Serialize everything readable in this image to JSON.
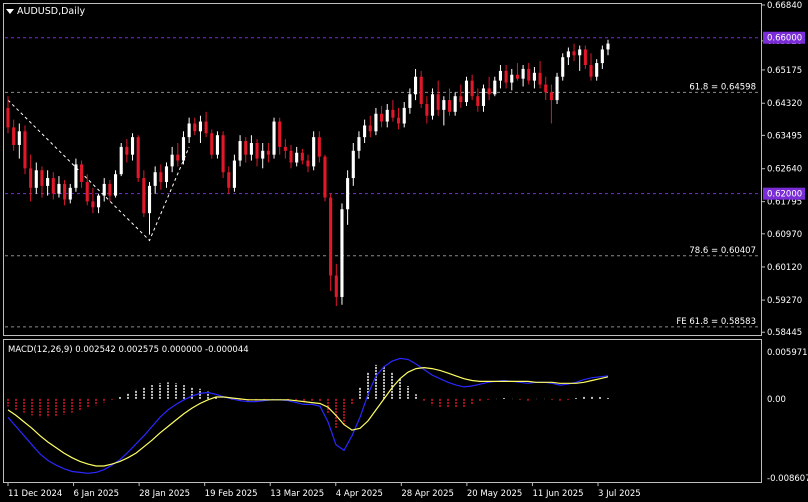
{
  "header": {
    "symbol_label": "AUDUSD,Daily"
  },
  "macd": {
    "label": "MACD(12,26,9) 0.002542 0.002575 0.000000 -0.000044",
    "scale_top": "0.005971",
    "scale_mid": "0.00",
    "scale_bottom": "-0.008607",
    "ylim": [
      -0.008607,
      0.005971
    ]
  },
  "price_axis": {
    "ticks": [
      "0.66840",
      "0.65920",
      "0.65175",
      "0.64320",
      "0.63495",
      "0.62640",
      "0.61795",
      "0.60970",
      "0.60120",
      "0.59270",
      "0.58445"
    ],
    "highlight_ticks": [
      "0.66000",
      "0.62000"
    ]
  },
  "levels": [
    {
      "label": "61.8 = 0.64598",
      "value": 0.64598
    },
    {
      "label": "78.6 = 0.60407",
      "value": 0.60407
    },
    {
      "label": "FE 61.8 = 0.58583",
      "value": 0.58583
    }
  ],
  "hlines": [
    0.66,
    0.62
  ],
  "time_axis": [
    "11 Dec 2024",
    "6 Jan 2025",
    "28 Jan 2025",
    "19 Feb 2025",
    "13 Mar 2025",
    "4 Apr 2025",
    "28 Apr 2025",
    "20 May 2025",
    "11 Jun 2025",
    "3 Jul 2025"
  ],
  "colors": {
    "bull": "#ffffff",
    "bear": "#e0182a",
    "macd_line": "#2828ff",
    "signal_line": "#ffff66",
    "level_line": "#8c8c8c",
    "hline": "#7a2cd6",
    "hist_pos": "#ffffff",
    "hist_neg": "#e0182a"
  },
  "chart_data": {
    "type": "candlestick",
    "title": "AUDUSD,Daily",
    "ylim": [
      0.584,
      0.6684
    ],
    "candles": [
      {
        "o": 0.642,
        "h": 0.645,
        "l": 0.6355,
        "c": 0.637
      },
      {
        "o": 0.637,
        "h": 0.639,
        "l": 0.631,
        "c": 0.6325
      },
      {
        "o": 0.6325,
        "h": 0.638,
        "l": 0.629,
        "c": 0.636
      },
      {
        "o": 0.636,
        "h": 0.6375,
        "l": 0.625,
        "c": 0.6265
      },
      {
        "o": 0.6265,
        "h": 0.63,
        "l": 0.618,
        "c": 0.6215
      },
      {
        "o": 0.6215,
        "h": 0.628,
        "l": 0.62,
        "c": 0.626
      },
      {
        "o": 0.626,
        "h": 0.627,
        "l": 0.619,
        "c": 0.622
      },
      {
        "o": 0.622,
        "h": 0.626,
        "l": 0.6195,
        "c": 0.624
      },
      {
        "o": 0.624,
        "h": 0.6255,
        "l": 0.6185,
        "c": 0.62
      },
      {
        "o": 0.62,
        "h": 0.6245,
        "l": 0.619,
        "c": 0.6225
      },
      {
        "o": 0.6225,
        "h": 0.6235,
        "l": 0.617,
        "c": 0.6185
      },
      {
        "o": 0.6185,
        "h": 0.6225,
        "l": 0.6175,
        "c": 0.6215
      },
      {
        "o": 0.6215,
        "h": 0.629,
        "l": 0.6205,
        "c": 0.6275
      },
      {
        "o": 0.6275,
        "h": 0.6285,
        "l": 0.6215,
        "c": 0.623
      },
      {
        "o": 0.623,
        "h": 0.625,
        "l": 0.617,
        "c": 0.618
      },
      {
        "o": 0.618,
        "h": 0.6215,
        "l": 0.615,
        "c": 0.6165
      },
      {
        "o": 0.6165,
        "h": 0.62,
        "l": 0.615,
        "c": 0.6195
      },
      {
        "o": 0.6195,
        "h": 0.624,
        "l": 0.618,
        "c": 0.6225
      },
      {
        "o": 0.6225,
        "h": 0.6235,
        "l": 0.618,
        "c": 0.6195
      },
      {
        "o": 0.6195,
        "h": 0.626,
        "l": 0.619,
        "c": 0.625
      },
      {
        "o": 0.625,
        "h": 0.633,
        "l": 0.6245,
        "c": 0.632
      },
      {
        "o": 0.632,
        "h": 0.634,
        "l": 0.628,
        "c": 0.63
      },
      {
        "o": 0.63,
        "h": 0.6355,
        "l": 0.6285,
        "c": 0.6345
      },
      {
        "o": 0.6345,
        "h": 0.635,
        "l": 0.623,
        "c": 0.624
      },
      {
        "o": 0.624,
        "h": 0.626,
        "l": 0.614,
        "c": 0.615
      },
      {
        "o": 0.615,
        "h": 0.623,
        "l": 0.6095,
        "c": 0.622
      },
      {
        "o": 0.622,
        "h": 0.627,
        "l": 0.62,
        "c": 0.6255
      },
      {
        "o": 0.6255,
        "h": 0.6275,
        "l": 0.621,
        "c": 0.623
      },
      {
        "o": 0.623,
        "h": 0.628,
        "l": 0.6215,
        "c": 0.627
      },
      {
        "o": 0.627,
        "h": 0.632,
        "l": 0.6255,
        "c": 0.63
      },
      {
        "o": 0.63,
        "h": 0.633,
        "l": 0.627,
        "c": 0.6285
      },
      {
        "o": 0.6285,
        "h": 0.636,
        "l": 0.6275,
        "c": 0.6345
      },
      {
        "o": 0.6345,
        "h": 0.6395,
        "l": 0.633,
        "c": 0.638
      },
      {
        "o": 0.638,
        "h": 0.6395,
        "l": 0.635,
        "c": 0.636
      },
      {
        "o": 0.636,
        "h": 0.64,
        "l": 0.633,
        "c": 0.6385
      },
      {
        "o": 0.6385,
        "h": 0.641,
        "l": 0.6345,
        "c": 0.6355
      },
      {
        "o": 0.6355,
        "h": 0.6365,
        "l": 0.629,
        "c": 0.63
      },
      {
        "o": 0.63,
        "h": 0.636,
        "l": 0.629,
        "c": 0.635
      },
      {
        "o": 0.635,
        "h": 0.636,
        "l": 0.624,
        "c": 0.6255
      },
      {
        "o": 0.6255,
        "h": 0.627,
        "l": 0.62,
        "c": 0.6215
      },
      {
        "o": 0.6215,
        "h": 0.63,
        "l": 0.6205,
        "c": 0.6285
      },
      {
        "o": 0.6285,
        "h": 0.635,
        "l": 0.627,
        "c": 0.6335
      },
      {
        "o": 0.6335,
        "h": 0.6345,
        "l": 0.628,
        "c": 0.63
      },
      {
        "o": 0.63,
        "h": 0.635,
        "l": 0.6285,
        "c": 0.633
      },
      {
        "o": 0.633,
        "h": 0.634,
        "l": 0.627,
        "c": 0.629
      },
      {
        "o": 0.629,
        "h": 0.633,
        "l": 0.6265,
        "c": 0.631
      },
      {
        "o": 0.631,
        "h": 0.633,
        "l": 0.628,
        "c": 0.63
      },
      {
        "o": 0.63,
        "h": 0.6395,
        "l": 0.629,
        "c": 0.6385
      },
      {
        "o": 0.6385,
        "h": 0.6395,
        "l": 0.63,
        "c": 0.632
      },
      {
        "o": 0.632,
        "h": 0.634,
        "l": 0.629,
        "c": 0.631
      },
      {
        "o": 0.631,
        "h": 0.6325,
        "l": 0.6265,
        "c": 0.628
      },
      {
        "o": 0.628,
        "h": 0.632,
        "l": 0.627,
        "c": 0.6305
      },
      {
        "o": 0.6305,
        "h": 0.6315,
        "l": 0.6275,
        "c": 0.6285
      },
      {
        "o": 0.6285,
        "h": 0.63,
        "l": 0.6255,
        "c": 0.627
      },
      {
        "o": 0.627,
        "h": 0.636,
        "l": 0.626,
        "c": 0.6345
      },
      {
        "o": 0.6345,
        "h": 0.636,
        "l": 0.628,
        "c": 0.6295
      },
      {
        "o": 0.6295,
        "h": 0.63,
        "l": 0.618,
        "c": 0.619
      },
      {
        "o": 0.619,
        "h": 0.62,
        "l": 0.595,
        "c": 0.599
      },
      {
        "o": 0.599,
        "h": 0.602,
        "l": 0.5912,
        "c": 0.5935
      },
      {
        "o": 0.5935,
        "h": 0.6175,
        "l": 0.5915,
        "c": 0.616
      },
      {
        "o": 0.616,
        "h": 0.626,
        "l": 0.612,
        "c": 0.624
      },
      {
        "o": 0.624,
        "h": 0.633,
        "l": 0.622,
        "c": 0.631
      },
      {
        "o": 0.631,
        "h": 0.636,
        "l": 0.629,
        "c": 0.6345
      },
      {
        "o": 0.6345,
        "h": 0.639,
        "l": 0.633,
        "c": 0.6375
      },
      {
        "o": 0.6375,
        "h": 0.64,
        "l": 0.6345,
        "c": 0.636
      },
      {
        "o": 0.636,
        "h": 0.642,
        "l": 0.635,
        "c": 0.6405
      },
      {
        "o": 0.6405,
        "h": 0.6425,
        "l": 0.637,
        "c": 0.6385
      },
      {
        "o": 0.6385,
        "h": 0.643,
        "l": 0.637,
        "c": 0.6415
      },
      {
        "o": 0.6415,
        "h": 0.644,
        "l": 0.6385,
        "c": 0.6395
      },
      {
        "o": 0.6395,
        "h": 0.642,
        "l": 0.6365,
        "c": 0.638
      },
      {
        "o": 0.638,
        "h": 0.6435,
        "l": 0.637,
        "c": 0.642
      },
      {
        "o": 0.642,
        "h": 0.647,
        "l": 0.6405,
        "c": 0.6455
      },
      {
        "o": 0.6455,
        "h": 0.652,
        "l": 0.644,
        "c": 0.65
      },
      {
        "o": 0.65,
        "h": 0.6515,
        "l": 0.642,
        "c": 0.643
      },
      {
        "o": 0.643,
        "h": 0.645,
        "l": 0.638,
        "c": 0.64
      },
      {
        "o": 0.64,
        "h": 0.647,
        "l": 0.639,
        "c": 0.6455
      },
      {
        "o": 0.6455,
        "h": 0.649,
        "l": 0.64,
        "c": 0.6415
      },
      {
        "o": 0.6415,
        "h": 0.645,
        "l": 0.6375,
        "c": 0.644
      },
      {
        "o": 0.644,
        "h": 0.647,
        "l": 0.64,
        "c": 0.641
      },
      {
        "o": 0.641,
        "h": 0.646,
        "l": 0.64,
        "c": 0.645
      },
      {
        "o": 0.645,
        "h": 0.648,
        "l": 0.642,
        "c": 0.6435
      },
      {
        "o": 0.6435,
        "h": 0.65,
        "l": 0.6425,
        "c": 0.649
      },
      {
        "o": 0.649,
        "h": 0.6505,
        "l": 0.644,
        "c": 0.645
      },
      {
        "o": 0.645,
        "h": 0.647,
        "l": 0.641,
        "c": 0.6425
      },
      {
        "o": 0.6425,
        "h": 0.648,
        "l": 0.641,
        "c": 0.647
      },
      {
        "o": 0.647,
        "h": 0.65,
        "l": 0.644,
        "c": 0.6455
      },
      {
        "o": 0.6455,
        "h": 0.65,
        "l": 0.645,
        "c": 0.649
      },
      {
        "o": 0.649,
        "h": 0.653,
        "l": 0.647,
        "c": 0.6515
      },
      {
        "o": 0.6515,
        "h": 0.653,
        "l": 0.647,
        "c": 0.6485
      },
      {
        "o": 0.6485,
        "h": 0.652,
        "l": 0.6465,
        "c": 0.6505
      },
      {
        "o": 0.6505,
        "h": 0.6535,
        "l": 0.649,
        "c": 0.6495
      },
      {
        "o": 0.6495,
        "h": 0.653,
        "l": 0.6475,
        "c": 0.652
      },
      {
        "o": 0.652,
        "h": 0.6535,
        "l": 0.648,
        "c": 0.649
      },
      {
        "o": 0.649,
        "h": 0.6525,
        "l": 0.647,
        "c": 0.651
      },
      {
        "o": 0.651,
        "h": 0.654,
        "l": 0.647,
        "c": 0.648
      },
      {
        "o": 0.648,
        "h": 0.65,
        "l": 0.644,
        "c": 0.646
      },
      {
        "o": 0.646,
        "h": 0.648,
        "l": 0.638,
        "c": 0.644
      },
      {
        "o": 0.644,
        "h": 0.651,
        "l": 0.643,
        "c": 0.65
      },
      {
        "o": 0.65,
        "h": 0.656,
        "l": 0.649,
        "c": 0.655
      },
      {
        "o": 0.655,
        "h": 0.6575,
        "l": 0.653,
        "c": 0.6565
      },
      {
        "o": 0.6565,
        "h": 0.6585,
        "l": 0.654,
        "c": 0.6555
      },
      {
        "o": 0.6555,
        "h": 0.658,
        "l": 0.6515,
        "c": 0.657
      },
      {
        "o": 0.657,
        "h": 0.658,
        "l": 0.652,
        "c": 0.653
      },
      {
        "o": 0.653,
        "h": 0.656,
        "l": 0.649,
        "c": 0.65
      },
      {
        "o": 0.65,
        "h": 0.6545,
        "l": 0.649,
        "c": 0.6535
      },
      {
        "o": 0.6535,
        "h": 0.658,
        "l": 0.652,
        "c": 0.657
      },
      {
        "o": 0.657,
        "h": 0.6595,
        "l": 0.6555,
        "c": 0.6585
      }
    ],
    "macd_line": [
      -0.002,
      -0.003,
      -0.004,
      -0.005,
      -0.006,
      -0.0067,
      -0.0072,
      -0.0076,
      -0.0079,
      -0.008,
      -0.0081,
      -0.008,
      -0.0077,
      -0.0072,
      -0.0066,
      -0.0058,
      -0.0049,
      -0.004,
      -0.003,
      -0.002,
      -0.0012,
      -0.0006,
      -0.0001,
      0.0003,
      0.0006,
      0.0007,
      0.0005,
      0.0002,
      0.0,
      -0.0002,
      -0.0003,
      -0.0003,
      -0.0002,
      -0.0001,
      -0.0001,
      -0.0002,
      -0.0004,
      -0.0006,
      -0.0006,
      -0.0008,
      -0.0025,
      -0.005,
      -0.0056,
      -0.004,
      -0.002,
      0.0005,
      0.0025,
      0.0035,
      0.0041,
      0.0044,
      0.0043,
      0.0038,
      0.0032,
      0.0026,
      0.0022,
      0.0018,
      0.0015,
      0.0013,
      0.0014,
      0.0016,
      0.0018,
      0.0019,
      0.002,
      0.0019,
      0.0018,
      0.0017,
      0.0018,
      0.0018,
      0.0017,
      0.0015,
      0.0016,
      0.0018,
      0.0021,
      0.0023,
      0.0024,
      0.0025
    ],
    "signal_line": [
      -0.0012,
      -0.0018,
      -0.0025,
      -0.0032,
      -0.004,
      -0.0047,
      -0.0053,
      -0.0059,
      -0.0064,
      -0.0068,
      -0.0071,
      -0.0073,
      -0.0073,
      -0.0071,
      -0.0068,
      -0.0064,
      -0.0059,
      -0.0052,
      -0.0045,
      -0.0037,
      -0.003,
      -0.0023,
      -0.0016,
      -0.001,
      -0.0005,
      -0.0001,
      0.0002,
      0.0002,
      0.0001,
      0.0,
      -0.0001,
      -0.0001,
      -0.0001,
      -0.0001,
      -0.0001,
      -0.0001,
      -0.0002,
      -0.0003,
      -0.0004,
      -0.0005,
      -0.0009,
      -0.0018,
      -0.0028,
      -0.0034,
      -0.0032,
      -0.0024,
      -0.0012,
      0.0,
      0.0012,
      0.0022,
      0.0029,
      0.0033,
      0.0034,
      0.0033,
      0.0031,
      0.0028,
      0.0025,
      0.0022,
      0.002,
      0.0019,
      0.0019,
      0.0019,
      0.0019,
      0.0019,
      0.0019,
      0.0019,
      0.0018,
      0.0018,
      0.0018,
      0.0017,
      0.0017,
      0.0017,
      0.0018,
      0.002,
      0.0022,
      0.0024
    ]
  }
}
